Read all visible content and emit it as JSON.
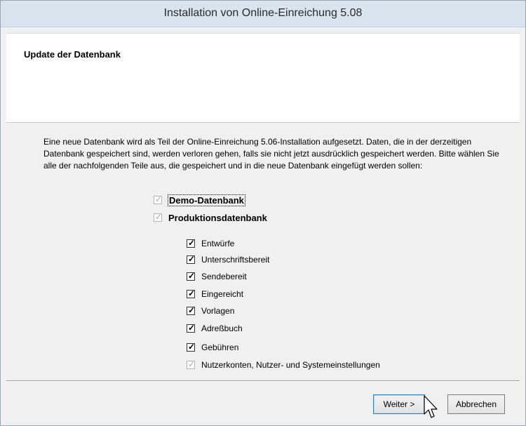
{
  "window": {
    "title": "Installation von Online-Einreichung 5.08"
  },
  "banner": {
    "title": "Update der Datenbank"
  },
  "description": "Eine neue Datenbank wird als Teil der Online-Einreichung 5.06-Installation aufgesetzt. Daten, die in der derzeitigen Datenbank gespeichert sind, werden verloren gehen, falls sie nicht jetzt ausdrücklich gespeichert werden. Bitte wählen Sie alle der nachfolgenden Teile aus, die gespeichert und in die neue Datenbank eingefügt werden sollen:",
  "top_options": [
    {
      "label": "Demo-Datenbank",
      "checked": true,
      "disabled": true
    },
    {
      "label": "Produktionsdatenbank",
      "checked": true,
      "disabled": true
    }
  ],
  "sub_options": [
    {
      "label": "Entwürfe",
      "checked": true,
      "disabled": false
    },
    {
      "label": "Unterschriftsbereit",
      "checked": true,
      "disabled": false
    },
    {
      "label": "Sendebereit",
      "checked": true,
      "disabled": false
    },
    {
      "label": "Eingereicht",
      "checked": true,
      "disabled": false
    },
    {
      "label": "Vorlagen",
      "checked": true,
      "disabled": false
    },
    {
      "label": "Adreßbuch",
      "checked": true,
      "disabled": false
    },
    {
      "label": "Gebühren",
      "checked": true,
      "disabled": false
    },
    {
      "label": "Nutzerkonten, Nutzer- und Systemeinstellungen",
      "checked": true,
      "disabled": true
    }
  ],
  "buttons": {
    "next": "Weiter >",
    "cancel": "Abbrechen"
  }
}
